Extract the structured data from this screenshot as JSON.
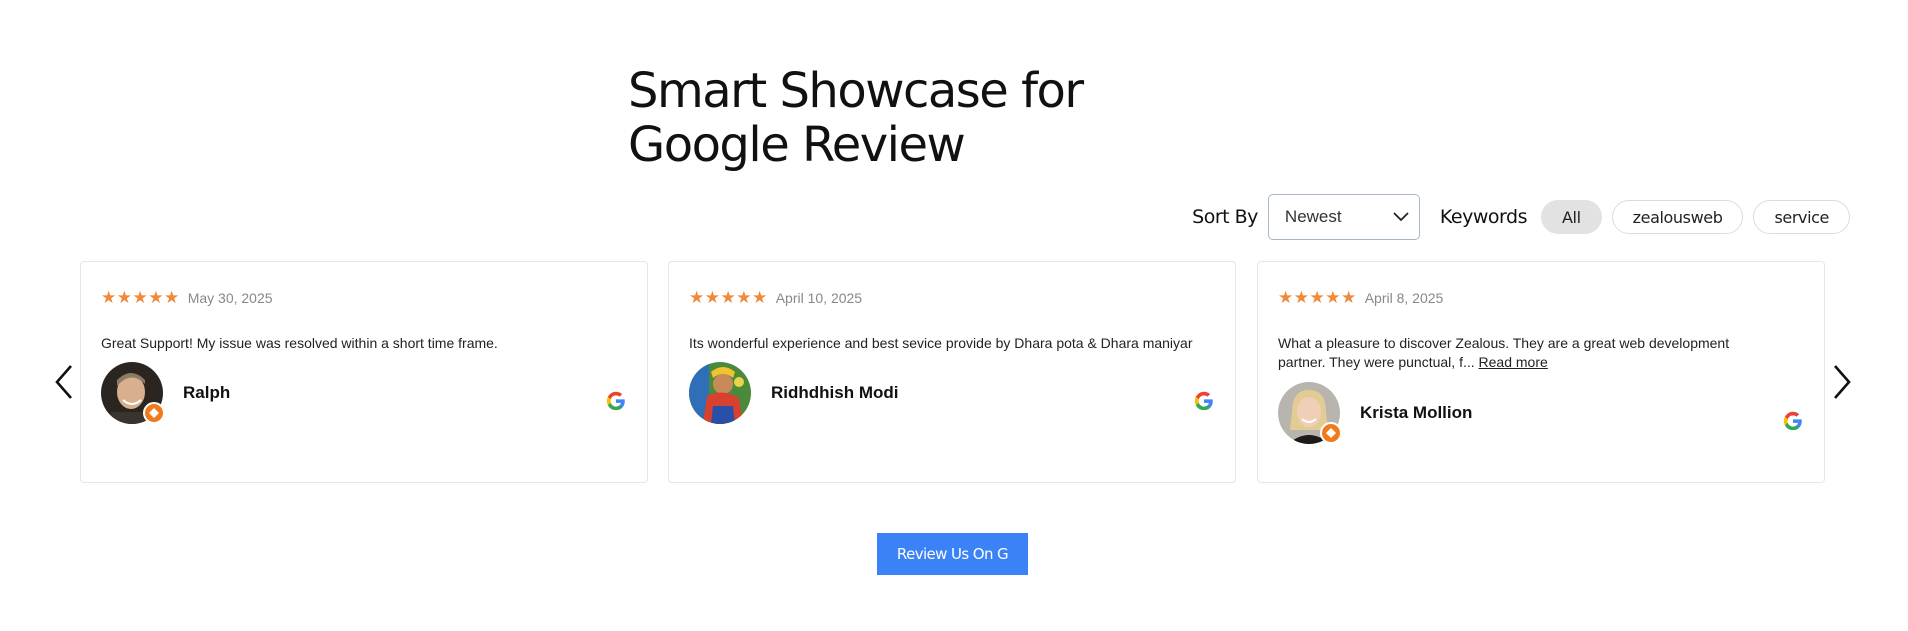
{
  "heading": {
    "line1": "Smart Showcase for",
    "line2": "Google Review"
  },
  "controls": {
    "sort_label": "Sort By",
    "sort_value": "Newest",
    "keywords_label": "Keywords",
    "keywords": [
      "All",
      "zealousweb",
      "service"
    ],
    "active_keyword": "All"
  },
  "reviews": [
    {
      "stars": "★★★★★",
      "rating": 5,
      "date": "May 30, 2025",
      "text": "Great Support! My issue was resolved within a short time frame.",
      "read_more": "",
      "author": "Ralph"
    },
    {
      "stars": "★★★★★",
      "rating": 5,
      "date": "April 10, 2025",
      "text": "Its wonderful experience and best sevice provide by Dhara pota & Dhara maniyar",
      "read_more": "",
      "author": "Ridhdhish Modi"
    },
    {
      "stars": "★★★★★",
      "rating": 5,
      "date": "April 8, 2025",
      "text": "What a pleasure to discover Zealous. They are a great web development partner. They were punctual, f...",
      "read_more": "Read more",
      "author": "Krista Mollion"
    }
  ],
  "cta_label": "Review Us On G",
  "colors": {
    "star": "#ef8a3c",
    "cta": "#3a82f6",
    "badge": "#f07a1c"
  },
  "icons": [
    "chevron-left-icon",
    "chevron-right-icon",
    "chevron-down-icon",
    "google-icon",
    "local-guide-badge-icon"
  ]
}
